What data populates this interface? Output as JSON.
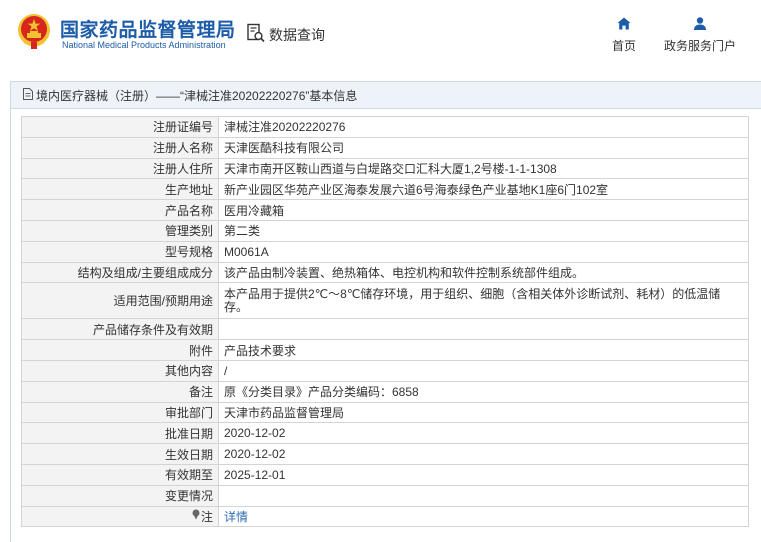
{
  "header": {
    "title_cn": "国家药品监督管理局",
    "title_en": "National Medical Products Administration",
    "search_label": "数据查询",
    "nav": {
      "home": "首页",
      "portal": "政务服务门户"
    }
  },
  "panel": {
    "title": "境内医疗器械（注册）——“津械注准20202220276”基本信息"
  },
  "rows": [
    {
      "key": "注册证编号",
      "value": "津械注准20202220276"
    },
    {
      "key": "注册人名称",
      "value": "天津医酷科技有限公司"
    },
    {
      "key": "注册人住所",
      "value": "天津市南开区鞍山西道与白堤路交口汇科大厦1,2号楼-1-1-1308"
    },
    {
      "key": "生产地址",
      "value": "新产业园区华苑产业区海泰发展六道6号海泰绿色产业基地K1座6门102室"
    },
    {
      "key": "产品名称",
      "value": "医用冷藏箱"
    },
    {
      "key": "管理类别",
      "value": "第二类"
    },
    {
      "key": "型号规格",
      "value": "M0061A"
    },
    {
      "key": "结构及组成/主要组成成分",
      "value": "该产品由制冷装置、绝热箱体、电控机构和软件控制系统部件组成。"
    },
    {
      "key": "适用范围/预期用途",
      "value": "本产品用于提供2℃～8℃储存环境，用于组织、细胞（含相关体外诊断试剂、耗材）的低温储存。"
    },
    {
      "key": "产品储存条件及有效期",
      "value": ""
    },
    {
      "key": "附件",
      "value": "产品技术要求"
    },
    {
      "key": "其他内容",
      "value": "/"
    },
    {
      "key": "备注",
      "value": "原《分类目录》产品分类编码：6858"
    },
    {
      "key": "审批部门",
      "value": "天津市药品监督管理局"
    },
    {
      "key": "批准日期",
      "value": "2020-12-02"
    },
    {
      "key": "生效日期",
      "value": "2020-12-02"
    },
    {
      "key": "有效期至",
      "value": "2025-12-01"
    },
    {
      "key": "变更情况",
      "value": ""
    },
    {
      "key": "注",
      "value": "详情"
    }
  ],
  "colors": {
    "brand_blue": "#1d5ca8",
    "emblem_red": "#d7261b",
    "emblem_gold": "#f2c230",
    "link_blue": "#2f6db5",
    "panel_head_bg": "#eef3f9",
    "key_cell_bg": "#f3f3f3"
  },
  "icons": {
    "emblem": "national-emblem-icon",
    "search": "database-search-icon",
    "home": "home-icon",
    "portal": "user-icon",
    "panel": "document-icon",
    "note": "pin-icon"
  }
}
